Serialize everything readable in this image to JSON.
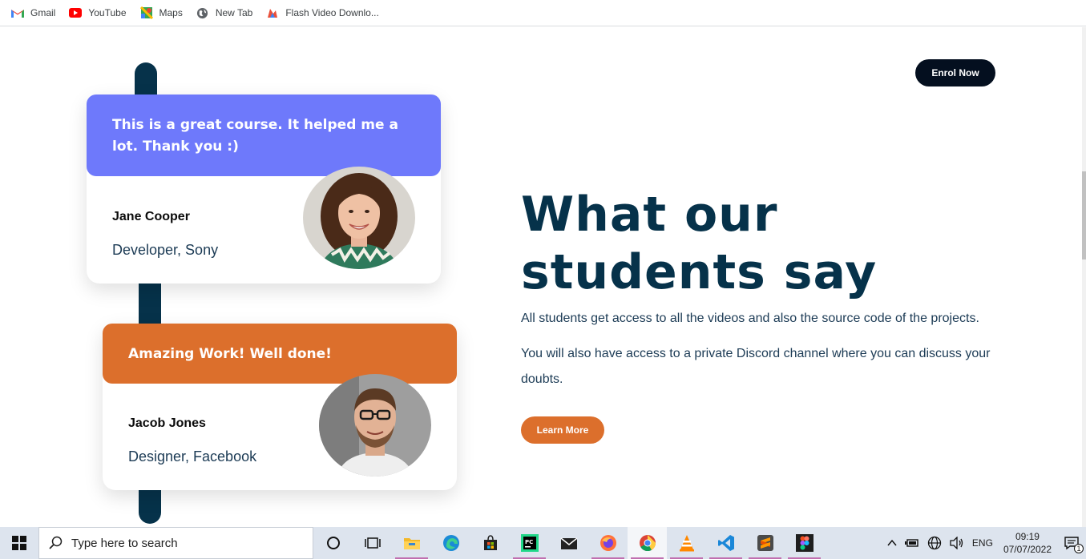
{
  "bookmarks": [
    {
      "label": "Gmail",
      "icon": "gmail-icon"
    },
    {
      "label": "YouTube",
      "icon": "youtube-icon"
    },
    {
      "label": "Maps",
      "icon": "maps-icon"
    },
    {
      "label": "New Tab",
      "icon": "globe-icon"
    },
    {
      "label": "Flash Video Downlo...",
      "icon": "flash-video-icon"
    }
  ],
  "header": {
    "enrol_label": "Enrol Now"
  },
  "testimonials": [
    {
      "quote": "This is a great course. It helped me a lot. Thank you :)",
      "name": "Jane Cooper",
      "role": "Developer, Sony",
      "color": "#6e79fb"
    },
    {
      "quote": "Amazing Work! Well done!",
      "name": "Jacob Jones",
      "role": "Designer, Facebook",
      "color": "#dc6f2c"
    }
  ],
  "section": {
    "heading": "What our students say",
    "para1": "All students get access to all the videos and also the source code of the projects.",
    "para2": "You will also have access to a private Discord channel where you can discuss your doubts.",
    "learn_label": "Learn More"
  },
  "taskbar": {
    "search_placeholder": "Type here to search",
    "apps": [
      "cortana-icon",
      "task-view-icon",
      "file-explorer-icon",
      "edge-icon",
      "store-icon",
      "pycharm-icon",
      "mail-icon",
      "firefox-icon",
      "chrome-icon",
      "vlc-icon",
      "vscode-icon",
      "sublime-icon",
      "figma-icon"
    ],
    "lang": "ENG",
    "time": "09:19",
    "date": "07/07/2022",
    "notifications": "1"
  },
  "colors": {
    "accent_dark": "#06324a",
    "purple": "#6e79fb",
    "orange": "#dc6f2c"
  }
}
